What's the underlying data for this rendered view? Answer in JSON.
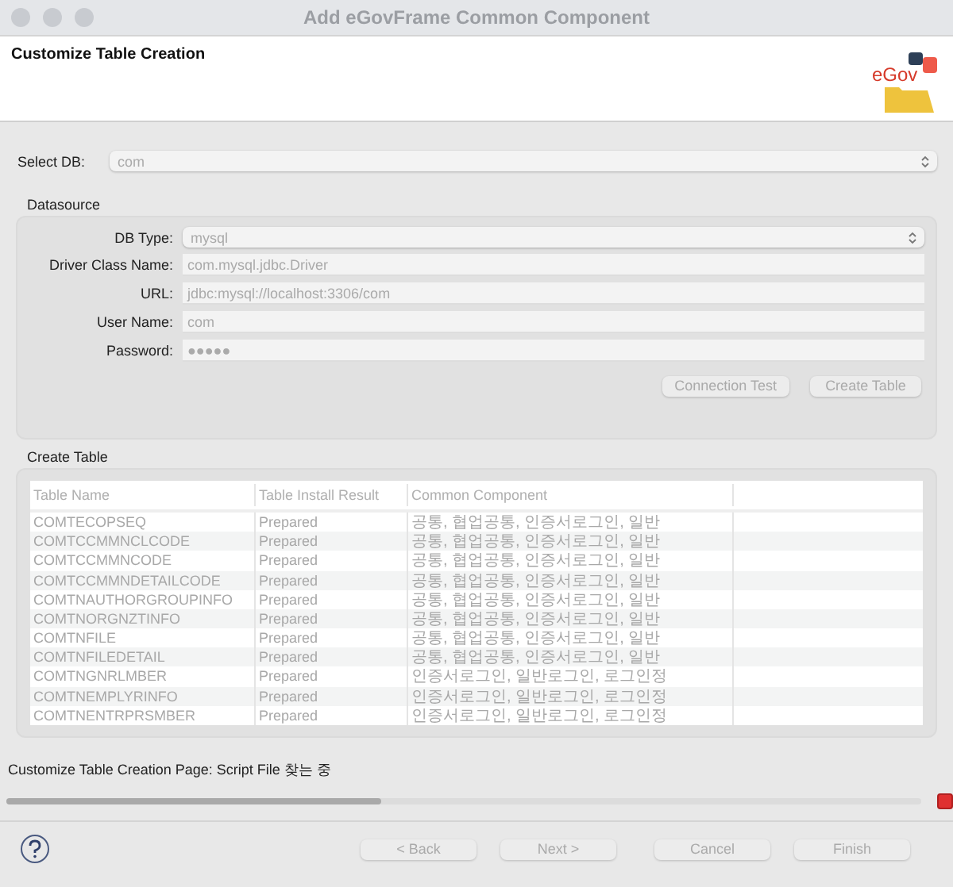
{
  "window": {
    "title": "Add eGovFrame Common Component"
  },
  "header": {
    "title": "Customize Table Creation",
    "logo_text": "eGov"
  },
  "select_db": {
    "label": "Select DB:",
    "value": "com",
    "disabled": true
  },
  "datasource": {
    "title": "Datasource",
    "fields": [
      {
        "kind": "select",
        "label": "DB Type:",
        "value": "mysql",
        "disabled": true
      },
      {
        "kind": "text",
        "label": "Driver Class Name:",
        "value": "com.mysql.jdbc.Driver",
        "disabled": true
      },
      {
        "kind": "text",
        "label": "URL:",
        "value": "jdbc:mysql://localhost:3306/com",
        "disabled": true
      },
      {
        "kind": "text",
        "label": "User Name:",
        "value": "com",
        "disabled": true
      },
      {
        "kind": "text",
        "label": "Password:",
        "value": "●●●●●",
        "disabled": true
      }
    ],
    "buttons": [
      {
        "label": "Connection Test",
        "disabled": true
      },
      {
        "label": "Create Table",
        "disabled": true
      }
    ]
  },
  "create_table": {
    "title": "Create Table",
    "columns": [
      "Table Name",
      "Table Install Result",
      "Common Component"
    ],
    "rows": [
      [
        "COMTECOPSEQ",
        "Prepared",
        "공통, 협업공통, 인증서로그인, 일반"
      ],
      [
        "COMTCCMMNCLCODE",
        "Prepared",
        "공통, 협업공통, 인증서로그인, 일반"
      ],
      [
        "COMTCCMMNCODE",
        "Prepared",
        "공통, 협업공통, 인증서로그인, 일반"
      ],
      [
        "COMTCCMMNDETAILCODE",
        "Prepared",
        "공통, 협업공통, 인증서로그인, 일반"
      ],
      [
        "COMTNAUTHORGROUPINFO",
        "Prepared",
        "공통, 협업공통, 인증서로그인, 일반"
      ],
      [
        "COMTNORGNZTINFO",
        "Prepared",
        "공통, 협업공통, 인증서로그인, 일반"
      ],
      [
        "COMTNFILE",
        "Prepared",
        "공통, 협업공통, 인증서로그인, 일반"
      ],
      [
        "COMTNFILEDETAIL",
        "Prepared",
        "공통, 협업공통, 인증서로그인, 일반"
      ],
      [
        "COMTNGNRLMBER",
        "Prepared",
        "인증서로그인, 일반로그인, 로그인정"
      ],
      [
        "COMTNEMPLYRINFO",
        "Prepared",
        "인증서로그인, 일반로그인, 로그인정"
      ],
      [
        "COMTNENTRPRSMBER",
        "Prepared",
        "인증서로그인, 일반로그인, 로그인정"
      ]
    ]
  },
  "status": {
    "text": "Customize Table Creation Page: Script File 찾는 중",
    "level": 0.41
  },
  "footer_buttons": [
    {
      "label": "< Back",
      "disabled": true
    },
    {
      "label": "Next >",
      "disabled": true
    },
    {
      "label": "Cancel",
      "disabled": true
    },
    {
      "label": "Finish",
      "disabled": true
    }
  ]
}
